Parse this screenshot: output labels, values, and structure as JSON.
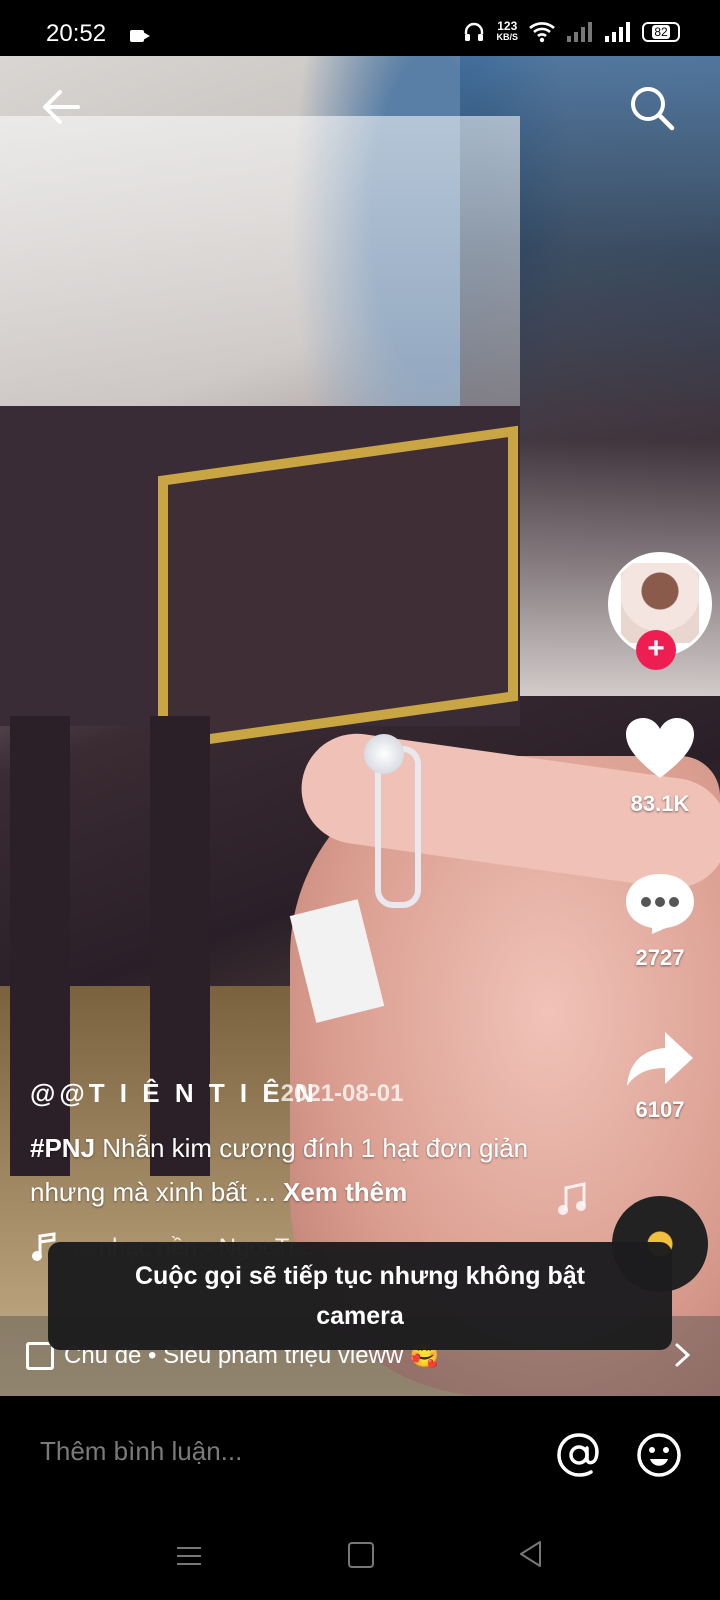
{
  "status": {
    "time": "20:52",
    "net_speed_value": "123",
    "net_speed_unit": "KB/S",
    "battery": "82"
  },
  "icons": {
    "back": "back-arrow-icon",
    "search": "search-icon",
    "like": "heart-icon",
    "comment": "comment-bubble-icon",
    "share": "share-arrow-icon",
    "music": "music-note-icon",
    "topic": "playlist-icon",
    "mention": "at-sign-icon",
    "emoji": "emoji-icon"
  },
  "colors": {
    "follow": "#ee1d52",
    "toast_bg": "#1c1c1e"
  },
  "rail": {
    "likes": "83.1K",
    "comments": "2727",
    "shares": "6107"
  },
  "post": {
    "username": "@@T I Ê N T I Ê N",
    "date": "· 2021-08-01",
    "hashtag": "#PNJ",
    "caption_text": " Nhẫn kim cương đính 1 hạt đơn giản nhưng mà xinh bất ... ",
    "see_more": "Xem thêm",
    "music_text": "... nhạc nền - NgocTr..."
  },
  "toast": {
    "message": "Cuộc gọi sẽ tiếp tục nhưng không bật camera"
  },
  "topic": {
    "label": "Chủ đề • Siêu phẩm triệu vieww 🥰"
  },
  "comment": {
    "placeholder": "Thêm bình luận..."
  }
}
